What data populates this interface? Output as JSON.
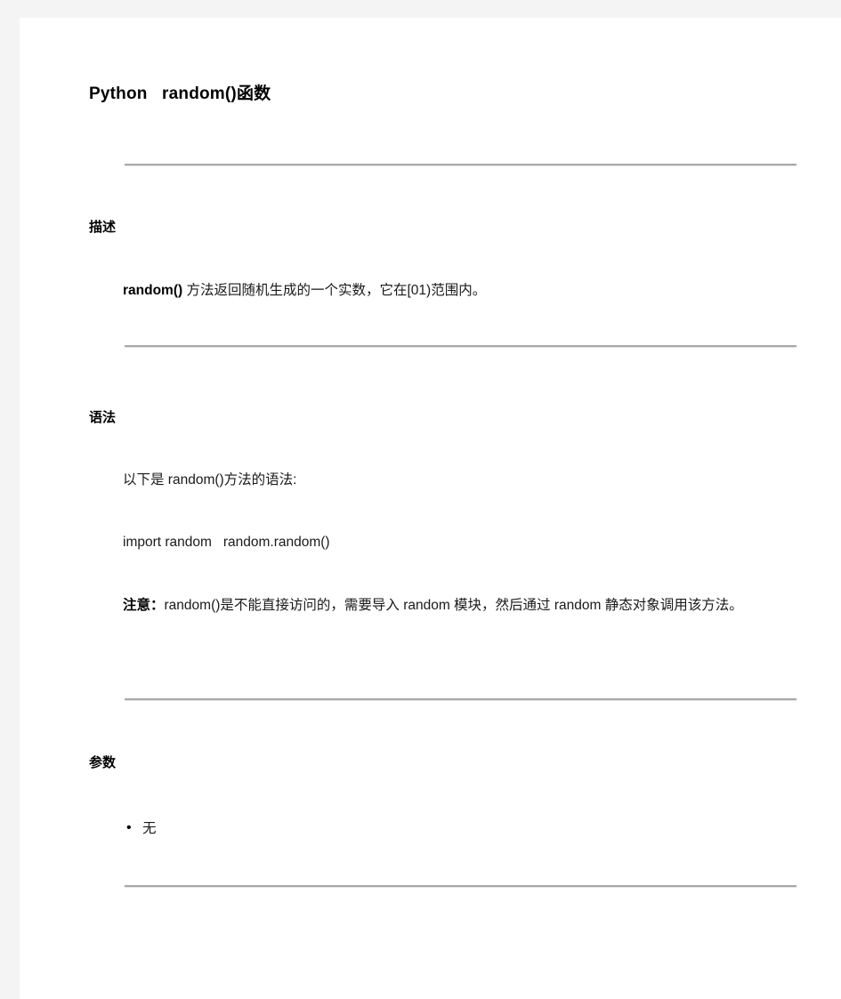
{
  "document": {
    "title": "Python   random()函数",
    "sections": [
      {
        "heading": "描述",
        "paragraph_bold": "random()",
        "paragraph_rest": " 方法返回随机生成的一个实数，它在[01)范围内。"
      },
      {
        "heading": "语法",
        "line1": "以下是 random()方法的语法:",
        "line2": "import random   random.random()",
        "note_label": "注意：",
        "note_text": "random()是不能直接访问的，需要导入 random 模块，然后通过 random 静态对象调用该方法。"
      },
      {
        "heading": "参数",
        "items": [
          "无"
        ]
      }
    ],
    "dividers": 4
  }
}
